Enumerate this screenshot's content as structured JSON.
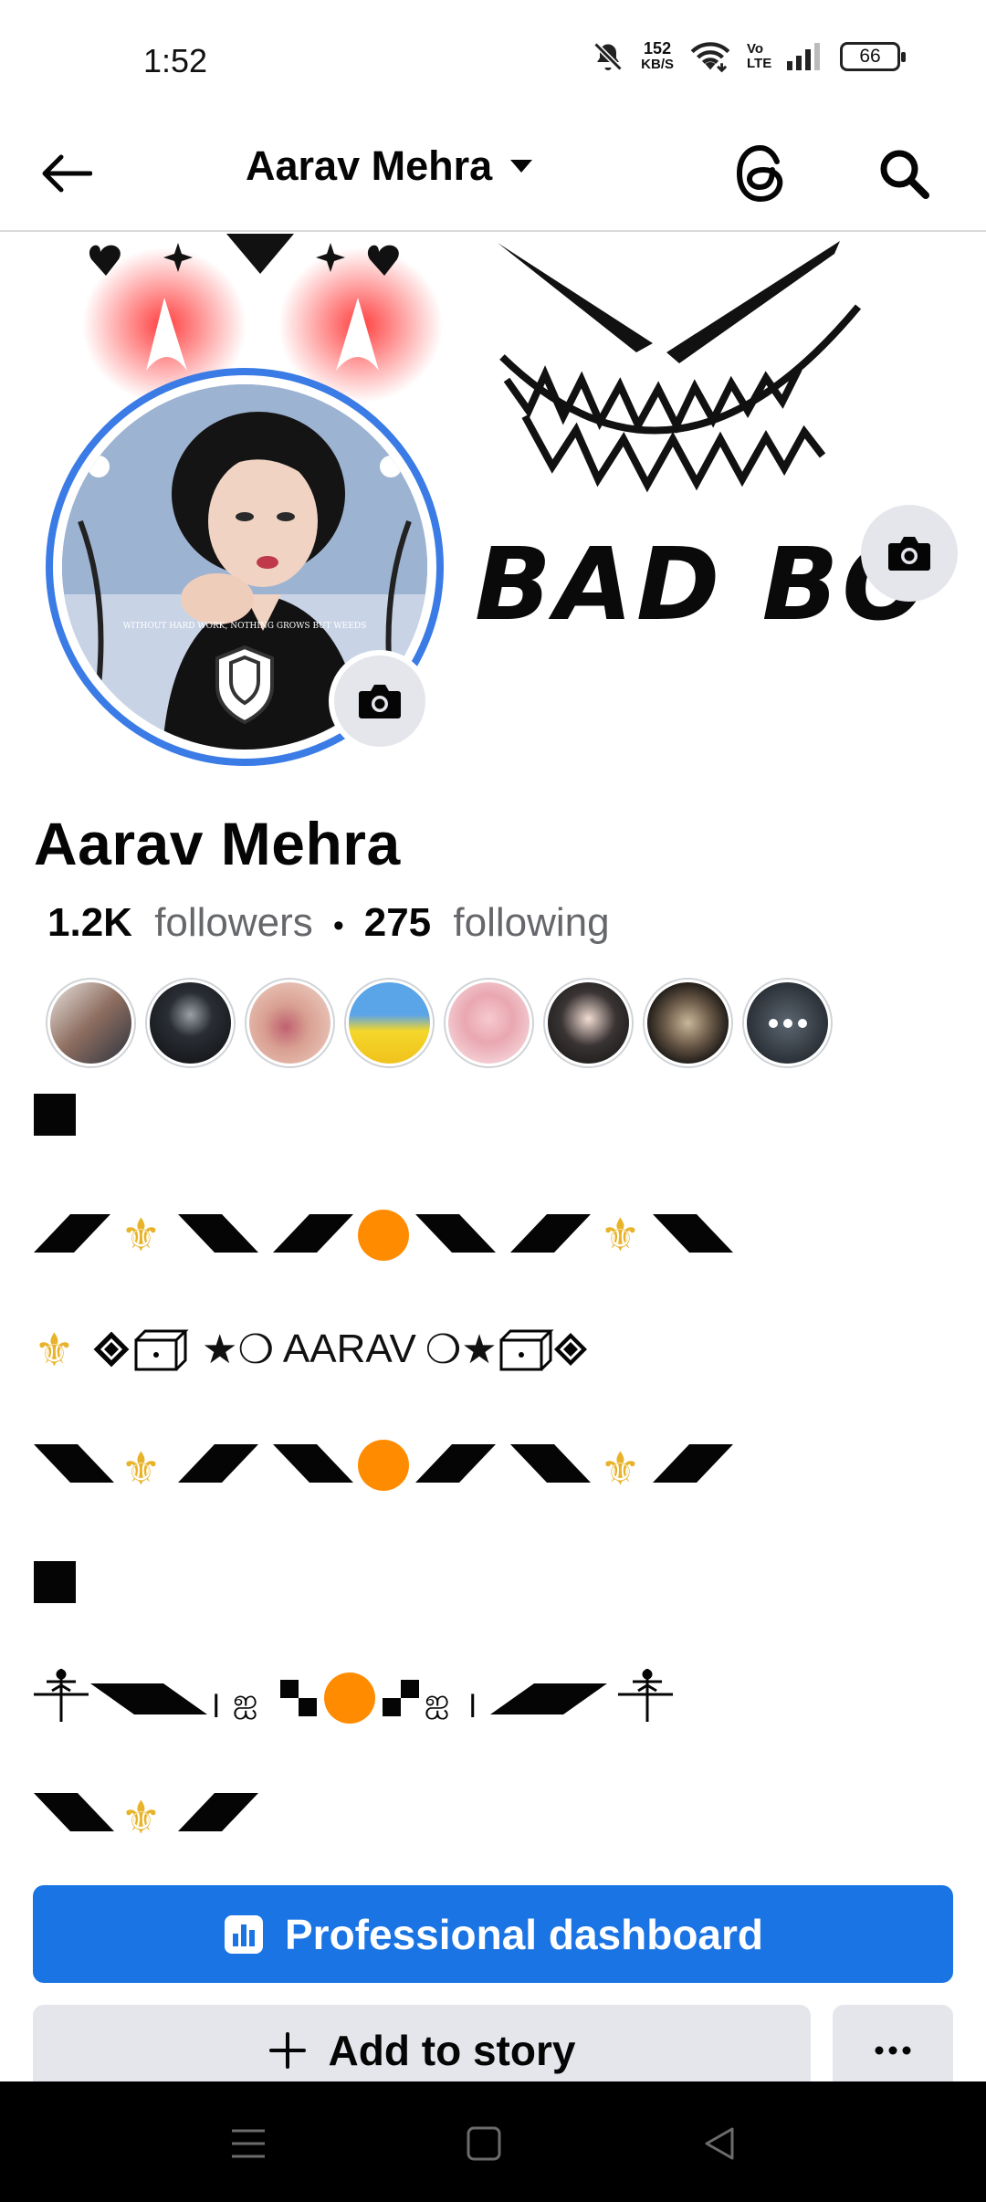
{
  "status_bar": {
    "time": "1:52",
    "net_speed_value": "152",
    "net_speed_unit": "KB/S",
    "network_label": "Vo LTE",
    "battery": "66"
  },
  "header": {
    "title": "Aarav Mehra"
  },
  "cover": {
    "text": "BAD BO"
  },
  "avatar": {
    "caption": "WITHOUT HARD WORK, NOTHING GROWS BUT WEEDS"
  },
  "profile": {
    "name": "Aarav Mehra",
    "followers_count": "1.2K",
    "followers_label": "followers",
    "separator": "•",
    "following_count": "275",
    "following_label": "following"
  },
  "bio": {
    "line3_text": "AARAV"
  },
  "buttons": {
    "professional_dashboard": "Professional dashboard",
    "add_to_story": "Add to story"
  },
  "colors": {
    "accent": "#1b74e4",
    "avatar_ring": "#3a7be6",
    "button_grey": "#e4e6eb",
    "muted_text": "#65676b",
    "orange_dot": "#ff8c00",
    "fleur_gold": "#e8b32a"
  },
  "icons": {
    "back": "arrow-left-icon",
    "dropdown": "caret-down-icon",
    "threads": "threads-icon",
    "search": "search-icon",
    "camera": "camera-icon",
    "dashboard": "bar-chart-icon",
    "add": "plus-icon",
    "more": "more-dots-icon"
  }
}
